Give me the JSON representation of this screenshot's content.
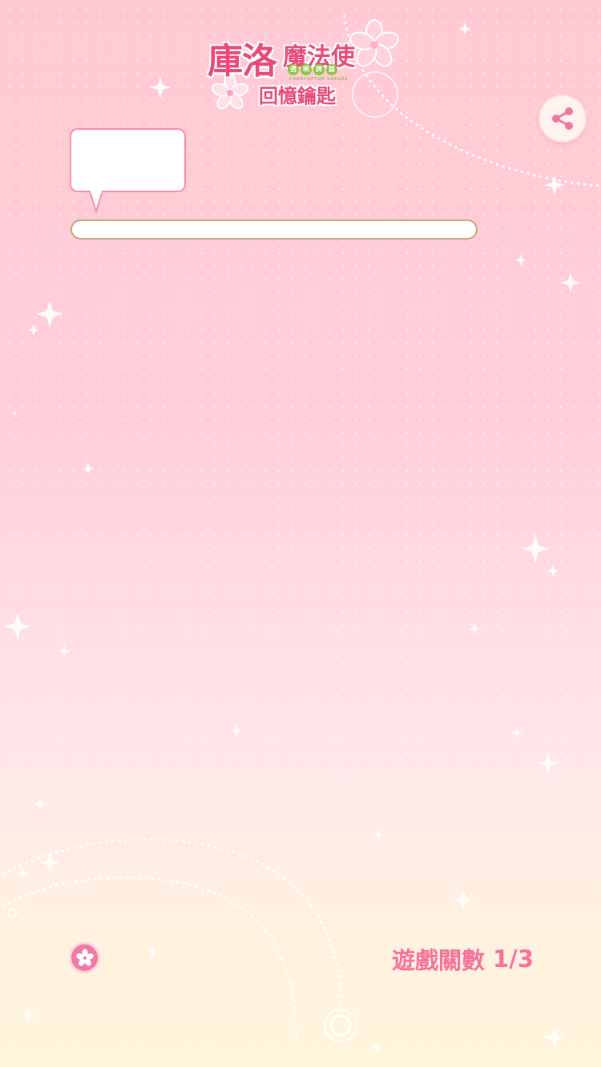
{
  "logo": {
    "title_main": "庫洛",
    "title_main2": "魔法使",
    "subtitle_chars": [
      "透",
      "明",
      "牌",
      "篇"
    ],
    "subtitle_en": "CARDCAPTOR SAKURA",
    "line2": "回憶鑰匙"
  },
  "share": {
    "icon": "share-icon"
  },
  "speech_bubble": {
    "text": ""
  },
  "progress": {
    "fraction": 0
  },
  "footer": {
    "flower_icon": "sakura-icon",
    "level_label": "遊戲關數",
    "level_value": "1/3"
  },
  "colors": {
    "accent_pink": "#f4729c",
    "logo_pink": "#e94a78",
    "bubble_border": "#f58fb0",
    "progress_border": "#c9a57a",
    "logo_green": "#8cc63f"
  }
}
